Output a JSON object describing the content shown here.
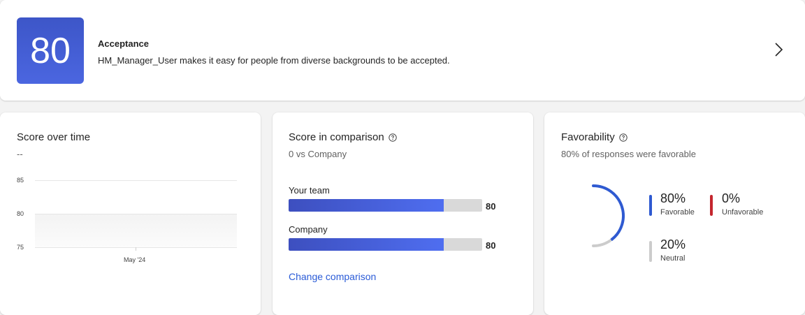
{
  "header": {
    "score": "80",
    "title": "Acceptance",
    "description": "HM_Manager_User makes it easy for people from diverse backgrounds to be accepted.",
    "accent_color": "#4b66e0"
  },
  "score_over_time": {
    "title": "Score over time",
    "subtitle": "--",
    "chart_data": {
      "type": "area",
      "y_ticks": [
        "85",
        "80",
        "75"
      ],
      "x_ticks": [
        "May '24"
      ],
      "ylim": [
        75,
        85
      ],
      "series": [],
      "grid": true
    }
  },
  "score_comparison": {
    "title": "Score in comparison",
    "subtitle": "0 vs Company",
    "info_icon": "info-icon",
    "rows": [
      {
        "label": "Your team",
        "value": "80",
        "fraction": 0.8
      },
      {
        "label": "Company",
        "value": "80",
        "fraction": 0.8
      }
    ],
    "link": "Change comparison"
  },
  "favorability": {
    "title": "Favorability",
    "subtitle": "80% of responses were favorable",
    "info_icon": "info-icon",
    "chart_data": {
      "type": "pie",
      "categories": [
        "Favorable",
        "Unfavorable",
        "Neutral"
      ],
      "values": [
        80,
        0,
        20
      ],
      "colors": [
        "#2f5ad1",
        "#c4262e",
        "#cccccc"
      ]
    },
    "stats": [
      {
        "pct": "80%",
        "name": "Favorable",
        "color": "#2f5ad1"
      },
      {
        "pct": "0%",
        "name": "Unfavorable",
        "color": "#c4262e"
      },
      {
        "pct": "20%",
        "name": "Neutral",
        "color": "#cccccc"
      }
    ]
  }
}
